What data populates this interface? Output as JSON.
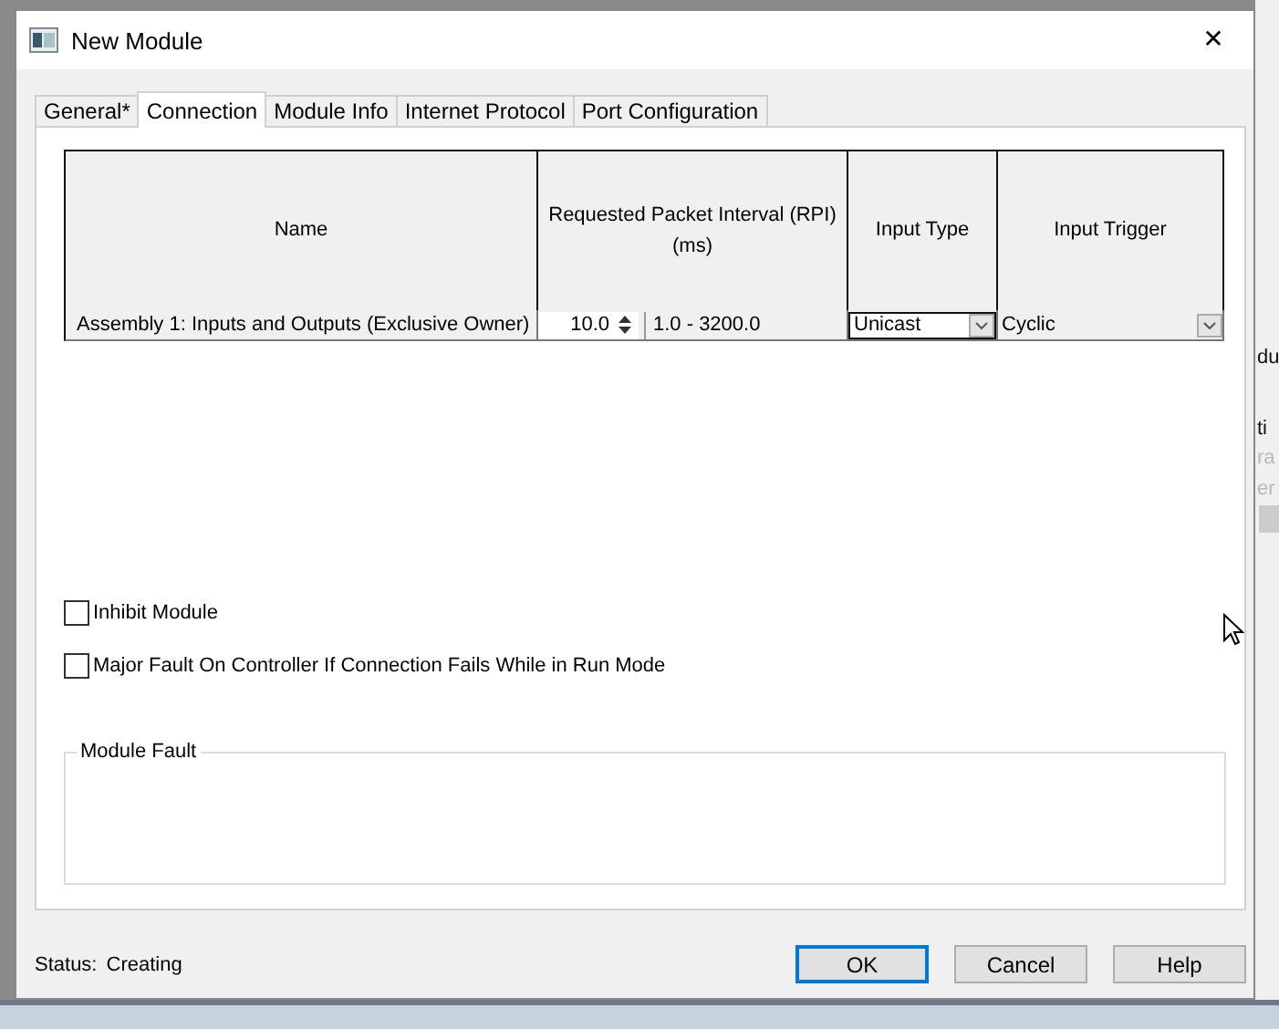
{
  "window": {
    "title": "New Module",
    "close": "✕"
  },
  "tabs": [
    {
      "label": "General*",
      "selected": false
    },
    {
      "label": "Connection",
      "selected": true
    },
    {
      "label": "Module Info",
      "selected": false
    },
    {
      "label": "Internet Protocol",
      "selected": false
    },
    {
      "label": "Port Configuration",
      "selected": false
    }
  ],
  "table": {
    "columns": [
      "Name",
      "Requested Packet Interval (RPI)\n(ms)",
      "Input Type",
      "Input Trigger"
    ],
    "rows": [
      {
        "name": "Assembly 1: Inputs and Outputs (Exclusive Owner)",
        "rpi": "10.0",
        "range": "1.0 - 3200.0",
        "input_type": "Unicast",
        "input_trigger": "Cyclic"
      }
    ]
  },
  "options": [
    {
      "label": "Inhibit Module",
      "checked": false
    },
    {
      "label": "Major Fault On Controller If Connection Fails While in Run Mode",
      "checked": false
    }
  ],
  "module_fault": {
    "title": "Module Fault"
  },
  "status": {
    "label": "Status:",
    "value": "Creating"
  },
  "buttons": [
    {
      "label": "OK",
      "selected": true
    },
    {
      "label": "Cancel",
      "selected": false
    },
    {
      "label": "Help",
      "selected": false
    }
  ],
  "background_window": {
    "texts": [
      "du",
      "ti",
      "ra",
      "er"
    ]
  }
}
